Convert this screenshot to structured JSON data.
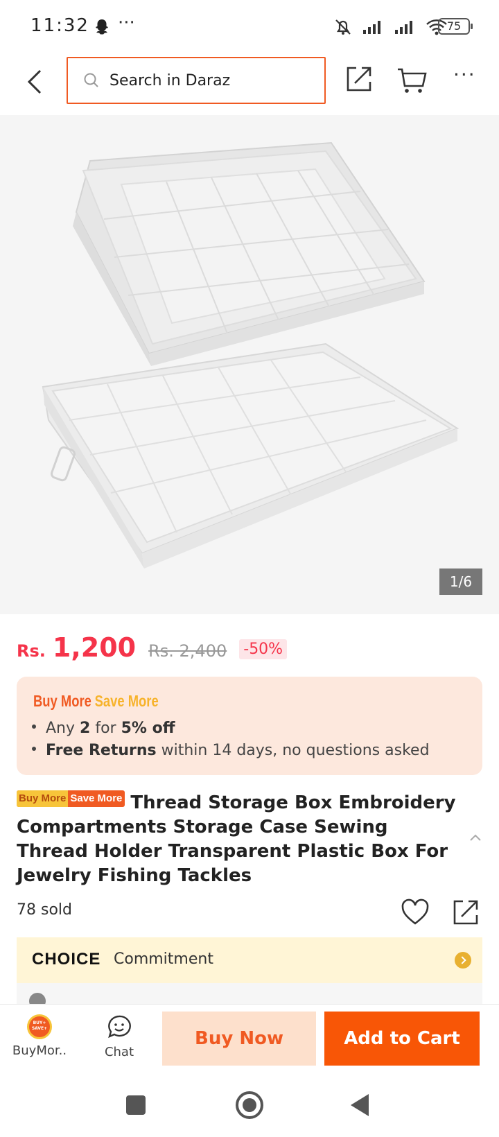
{
  "status_bar": {
    "time": "11:32",
    "more": "···",
    "battery": "75"
  },
  "header": {
    "search_placeholder": "Search in Daraz",
    "more_label": "···"
  },
  "gallery": {
    "counter": "1/6"
  },
  "price": {
    "currency": "Rs.",
    "value": "1,200",
    "original": "Rs. 2,400",
    "discount": "-50%"
  },
  "promo": {
    "badge_left": "Buy More",
    "badge_right": "Save More",
    "line1_prefix": "Any ",
    "line1_bold1": "2",
    "line1_mid": " for ",
    "line1_bold2": "5% off",
    "line2_bold": "Free Returns",
    "line2_rest": " within 14 days, no questions asked"
  },
  "product": {
    "tag_left": "Buy More",
    "tag_right": "Save More",
    "title": "Thread Storage Box Embroidery Compartments Storage Case Sewing Thread Holder Transparent Plastic Box For Jewelry Fishing Tackles",
    "sold": "78 sold"
  },
  "choice": {
    "logo": "CHOICE",
    "text": "Commitment"
  },
  "bottom_bar": {
    "buymore_label": "BuyMor..",
    "chat_label": "Chat",
    "buy_now": "Buy Now",
    "add_to_cart": "Add to Cart"
  },
  "colors": {
    "accent": "#f85606",
    "price": "#f5344a",
    "promo_bg": "#fde8dd",
    "choice_bg": "#fff5d6"
  }
}
